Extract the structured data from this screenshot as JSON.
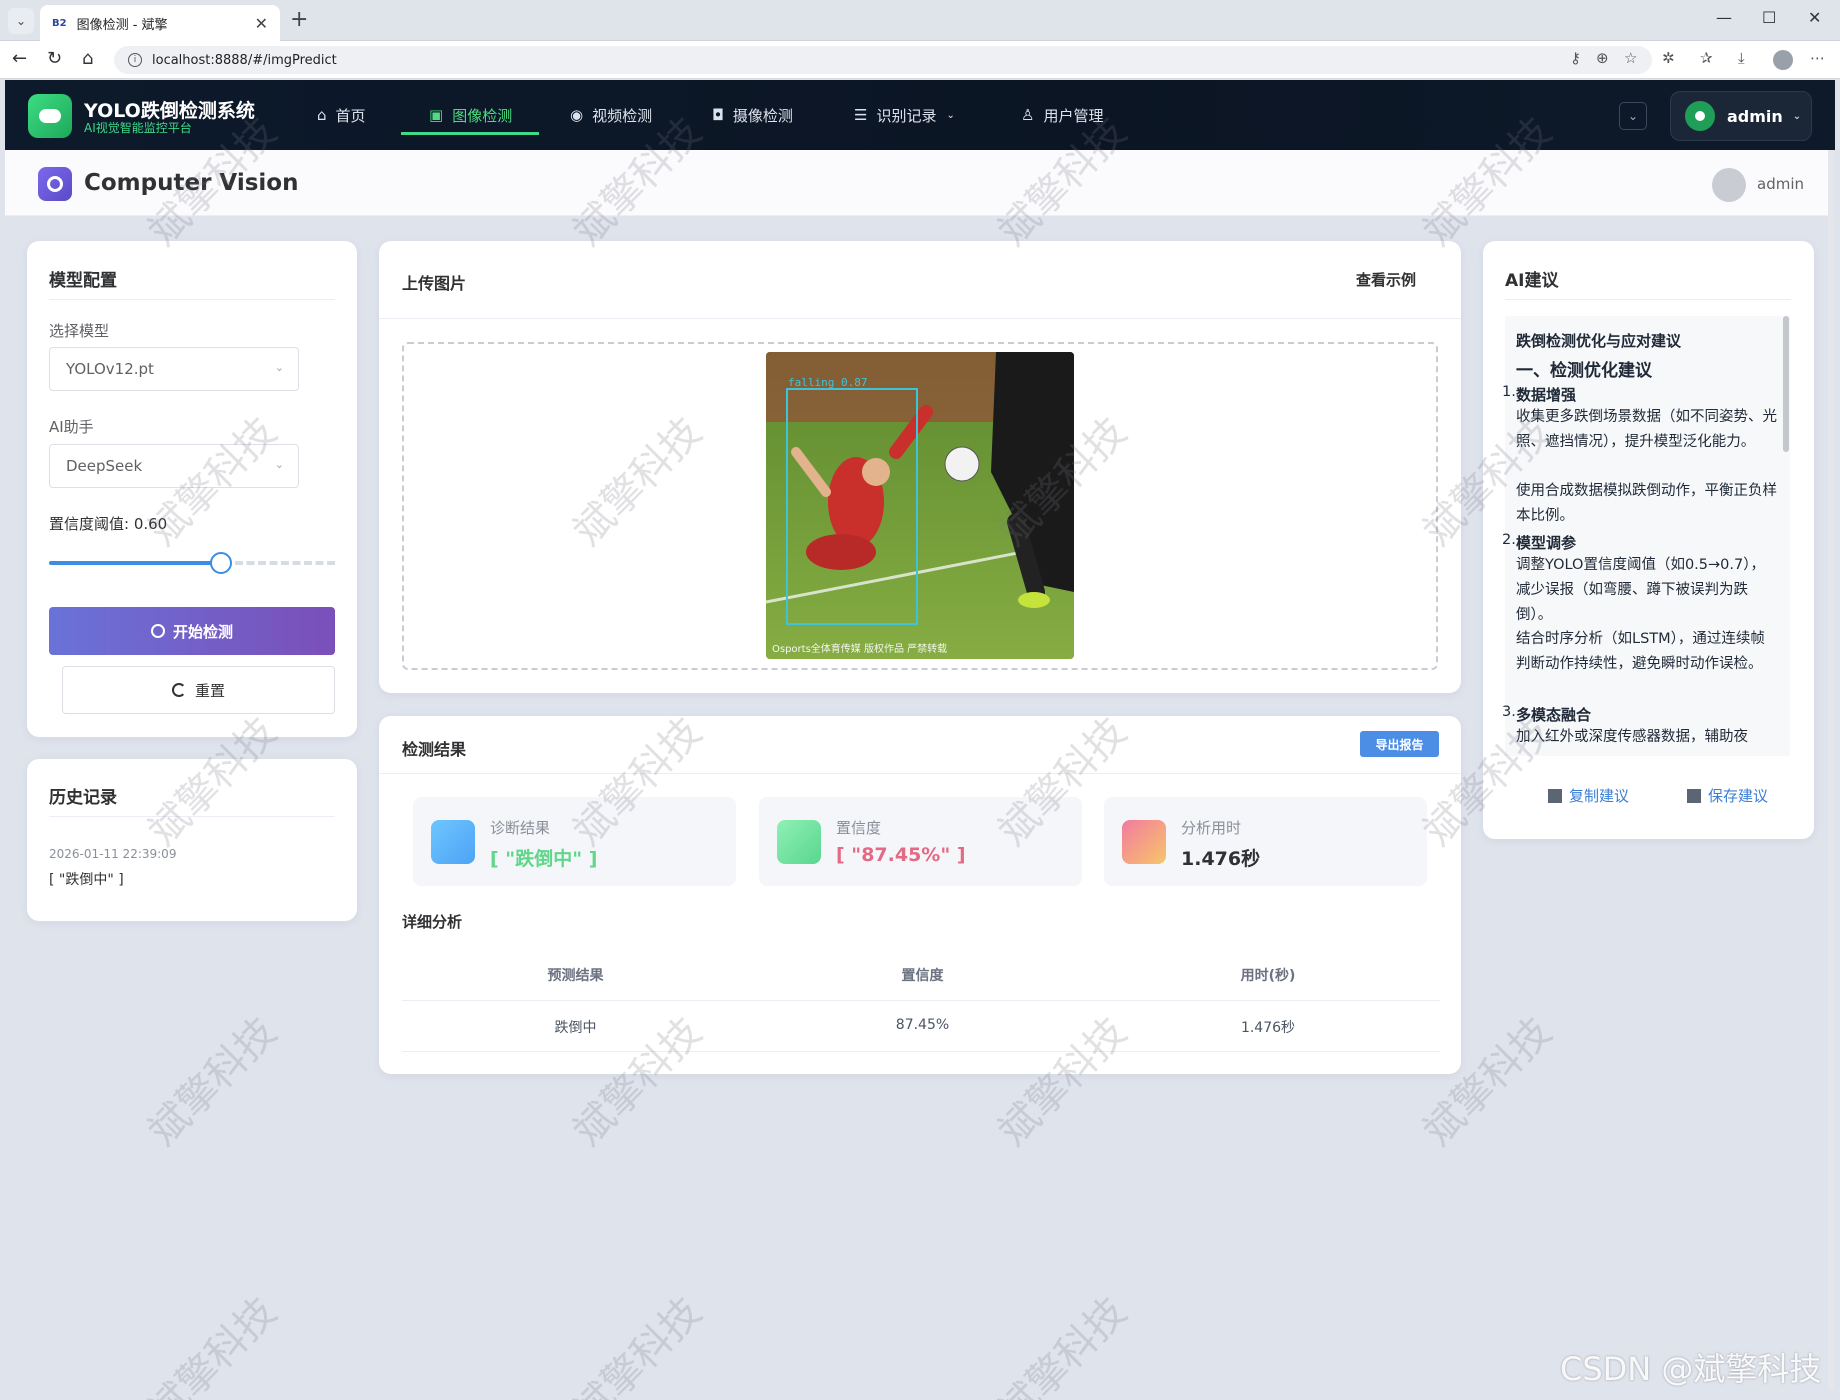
{
  "browser": {
    "tab_title": "图像检测 - 斌擎",
    "tab_favicon": "B2",
    "url": "localhost:8888/#/imgPredict"
  },
  "header": {
    "brand_title": "YOLO跌倒检测系统",
    "brand_subtitle": "AI视觉智能监控平台",
    "nav": [
      {
        "label": "首页",
        "icon": "home-icon"
      },
      {
        "label": "图像检测",
        "icon": "image-icon",
        "active": true
      },
      {
        "label": "视频检测",
        "icon": "play-circle-icon"
      },
      {
        "label": "摄像检测",
        "icon": "camera-icon"
      },
      {
        "label": "识别记录",
        "icon": "document-icon",
        "has_dropdown": true
      },
      {
        "label": "用户管理",
        "icon": "user-icon"
      }
    ],
    "user": "admin"
  },
  "subheader": {
    "title": "Computer Vision",
    "user": "admin"
  },
  "model_config": {
    "title": "模型配置",
    "model_label": "选择模型",
    "model_value": "YOLOv12.pt",
    "assistant_label": "AI助手",
    "assistant_value": "DeepSeek",
    "threshold_label": "置信度阈值: 0.60",
    "threshold": 0.6,
    "start_button": "开始检测",
    "reset_button": "重置"
  },
  "history": {
    "title": "历史记录",
    "items": [
      {
        "time": "2026-01-11 22:39:09",
        "result": "[ \"跌倒中\" ]"
      }
    ]
  },
  "upload": {
    "title": "上传图片",
    "example_link": "查看示例",
    "detection_label": "falling  0.87",
    "image_caption": "Osports全体育传媒 版权作品 严禁转载"
  },
  "results": {
    "title": "检测结果",
    "export_button": "导出报告",
    "metrics": [
      {
        "label": "诊断结果",
        "value": "[ \"跌倒中\" ]",
        "color": "#5fd68a"
      },
      {
        "label": "置信度",
        "value": "[ \"87.45%\" ]",
        "color": "#e36a84"
      },
      {
        "label": "分析用时",
        "value": "1.476秒",
        "color": "#303133"
      }
    ],
    "detail_title": "详细分析",
    "table": {
      "headers": [
        "预测结果",
        "置信度",
        "用时(秒)"
      ],
      "rows": [
        [
          "跌倒中",
          "87.45%",
          "1.476秒"
        ]
      ]
    }
  },
  "ai": {
    "title": "AI建议",
    "heading": "跌倒检测优化与应对建议",
    "section": "一、检测优化建议",
    "items": [
      {
        "num": "1.",
        "title": "数据增强",
        "lines": [
          "收集更多跌倒场景数据（如不同姿势、光照、遮挡情况），提升模型泛化能力。",
          "使用合成数据模拟跌倒动作，平衡正负样本比例。"
        ]
      },
      {
        "num": "2.",
        "title": "模型调参",
        "lines": [
          "调整YOLO置信度阈值（如0.5→0.7），减少误报（如弯腰、蹲下被误判为跌倒）。",
          "结合时序分析（如LSTM），通过连续帧判断动作持续性，避免瞬时动作误检。"
        ]
      },
      {
        "num": "3.",
        "title": "多模态融合",
        "lines": [
          "加入红外或深度传感器数据，辅助夜"
        ]
      }
    ],
    "copy_button": "复制建议",
    "save_button": "保存建议"
  },
  "watermark": "斌擎科技",
  "footer_credit": "CSDN @斌擎科技"
}
